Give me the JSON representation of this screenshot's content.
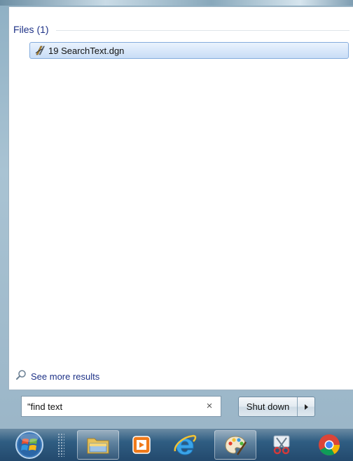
{
  "results": {
    "group_title": "Files (1)",
    "items": [
      {
        "label": "19 SearchText.dgn",
        "icon": "microstation-file-icon"
      }
    ],
    "see_more_label": "See more results"
  },
  "search": {
    "value": "\"find text",
    "clear_symbol": "×"
  },
  "shutdown": {
    "label": "Shut down",
    "arrow_symbol": "▸"
  },
  "taskbar": {
    "buttons": [
      {
        "name": "start-orb",
        "icon": "windows-logo-icon"
      },
      {
        "name": "windows-explorer",
        "icon": "folder-icon"
      },
      {
        "name": "media-player",
        "icon": "media-player-icon"
      },
      {
        "name": "internet-explorer",
        "icon": "internet-explorer-icon"
      },
      {
        "name": "paint",
        "icon": "paint-palette-icon"
      },
      {
        "name": "snipping-tool",
        "icon": "scissors-icon"
      },
      {
        "name": "chrome",
        "icon": "chrome-icon"
      }
    ]
  }
}
